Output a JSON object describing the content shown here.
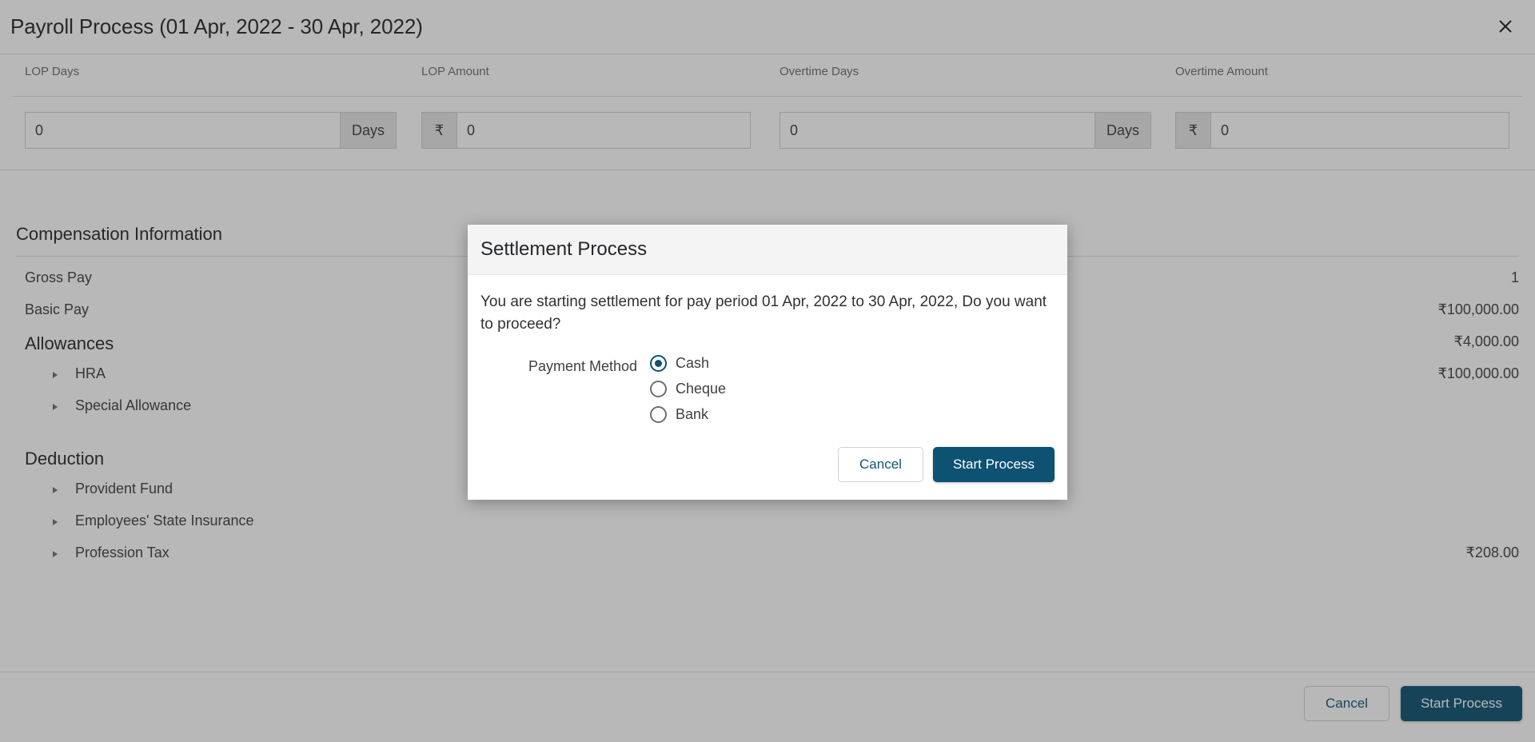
{
  "window": {
    "title": "Payroll Process (01 Apr, 2022 - 30 Apr, 2022)",
    "close_icon": "close-icon"
  },
  "fields": [
    {
      "label": "LOP Days",
      "value": "0",
      "addon": "Days",
      "addon_side": "right"
    },
    {
      "label": "LOP Amount",
      "value": "0",
      "addon": "₹",
      "addon_side": "left"
    },
    {
      "label": "Overtime Days",
      "value": "0",
      "addon": "Days",
      "addon_side": "right"
    },
    {
      "label": "Overtime Amount",
      "value": "0",
      "addon": "₹",
      "addon_side": "left"
    }
  ],
  "compensation": {
    "section_title": "Compensation Information",
    "rows": [
      {
        "label": "Gross Pay",
        "value": "1",
        "level": "item"
      },
      {
        "label": "Basic Pay",
        "value": "₹100,000.00",
        "level": "item"
      },
      {
        "label": "Allowances",
        "value": "₹4,000.00",
        "level": "header"
      },
      {
        "label": "HRA",
        "value": "₹100,000.00",
        "level": "child"
      },
      {
        "label": "Special Allowance",
        "value": "",
        "level": "child"
      },
      {
        "label": "Deduction",
        "value": "",
        "level": "header"
      },
      {
        "label": "Provident Fund",
        "value": "",
        "level": "child"
      },
      {
        "label": "Employees' State Insurance",
        "value": "",
        "level": "child"
      },
      {
        "label": "Profession Tax",
        "value": "₹208.00",
        "level": "child"
      }
    ]
  },
  "footer": {
    "cancel_label": "Cancel",
    "start_label": "Start Process"
  },
  "modal": {
    "title": "Settlement Process",
    "message": "You are starting settlement for pay period 01 Apr, 2022 to 30 Apr, 2022, Do you want to proceed?",
    "payment_method_label": "Payment Method",
    "payment_methods": [
      {
        "label": "Cash",
        "selected": true
      },
      {
        "label": "Cheque",
        "selected": false
      },
      {
        "label": "Bank",
        "selected": false
      }
    ],
    "cancel_label": "Cancel",
    "start_label": "Start Process"
  },
  "colors": {
    "primary": "#0d5272",
    "link": "#0f5675",
    "text": "#3d4044",
    "muted": "#6d6e71",
    "overlay": "rgba(40,40,40,0.33)"
  }
}
